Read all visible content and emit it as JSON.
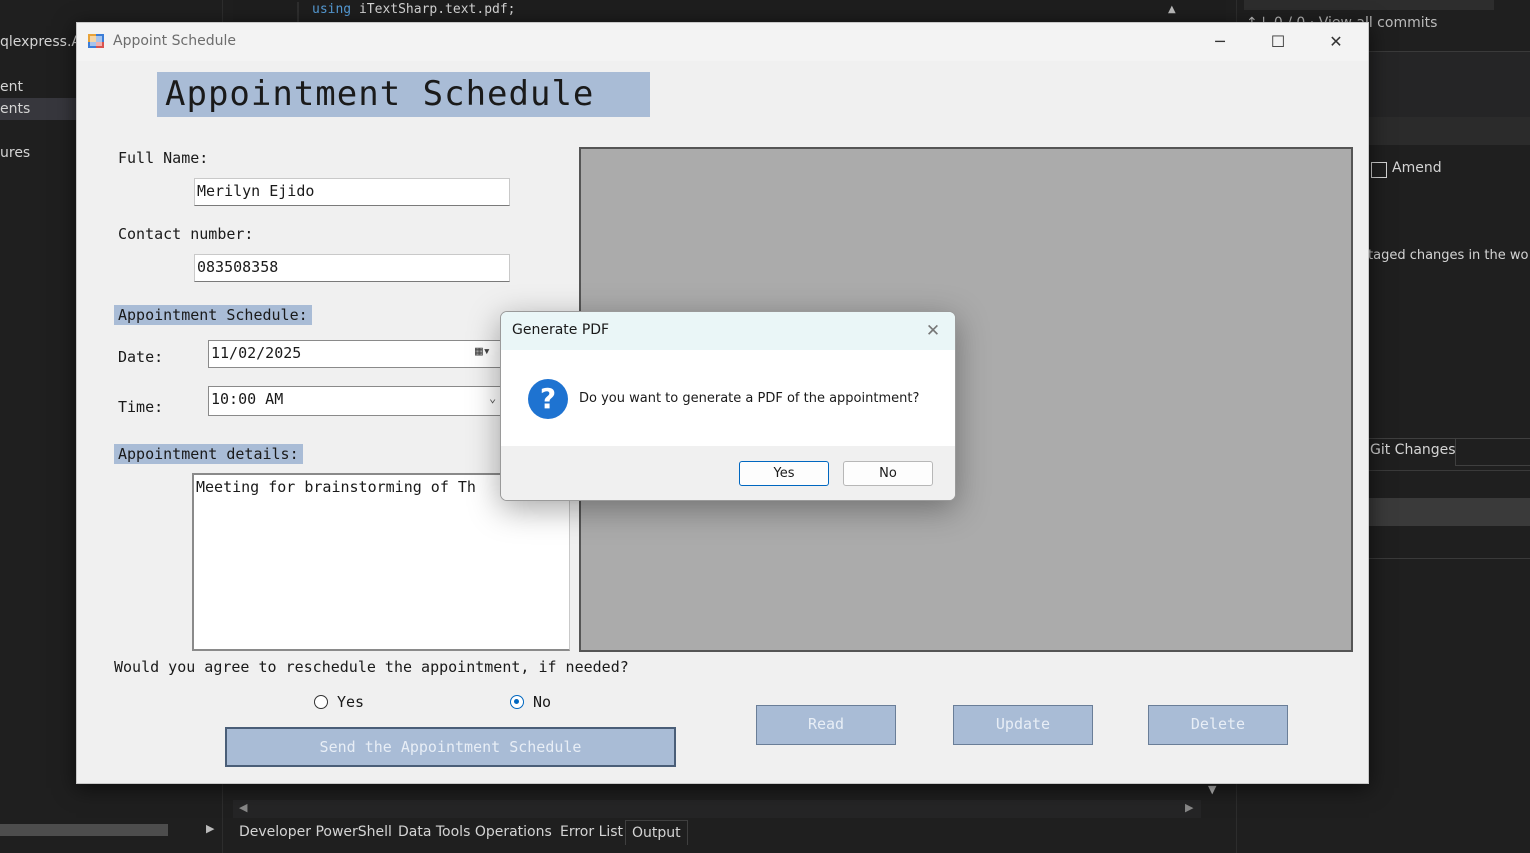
{
  "ide": {
    "editor_keyword": "using",
    "editor_code": "iTextSharp.text.pdf;",
    "left_items": [
      "qlexpress.A",
      "ent",
      "ents",
      "ures"
    ],
    "right_commits": "↑↓ 0 / 0 · View all commits",
    "right_amend": "Amend",
    "right_message": "taged changes in the wo",
    "right_git_changes": "Git Changes",
    "bottom_tabs": [
      "Developer PowerShell",
      "Data Tools Operations",
      "Error List",
      "Output"
    ]
  },
  "window": {
    "title": "Appoint Schedule",
    "heading": "Appointment Schedule",
    "full_name_label": "Full Name:",
    "full_name_value": "Merilyn Ejido",
    "contact_label": "Contact number:",
    "contact_value": "083508358",
    "schedule_label": "Appointment Schedule:",
    "date_label": "Date:",
    "date_value": "11/02/2025",
    "time_label": "Time:",
    "time_value": "10:00 AM",
    "details_label": "Appointment details:",
    "details_value": "Meeting for brainstorming of Th",
    "reschedule_question": "Would you agree to reschedule the appointment, if needed?",
    "radio_yes": "Yes",
    "radio_no": "No",
    "reschedule_selected": "No",
    "send_button": "Send the Appointment Schedule",
    "read_button": "Read",
    "update_button": "Update",
    "delete_button": "Delete"
  },
  "dialog": {
    "title": "Generate PDF",
    "message": "Do you want to generate a PDF of the appointment?",
    "yes_button": "Yes",
    "no_button": "No"
  },
  "colors": {
    "accent_highlight": "#a9bcd6",
    "dialog_question_icon": "#1e73d1",
    "radio_selected": "#0067c0"
  }
}
